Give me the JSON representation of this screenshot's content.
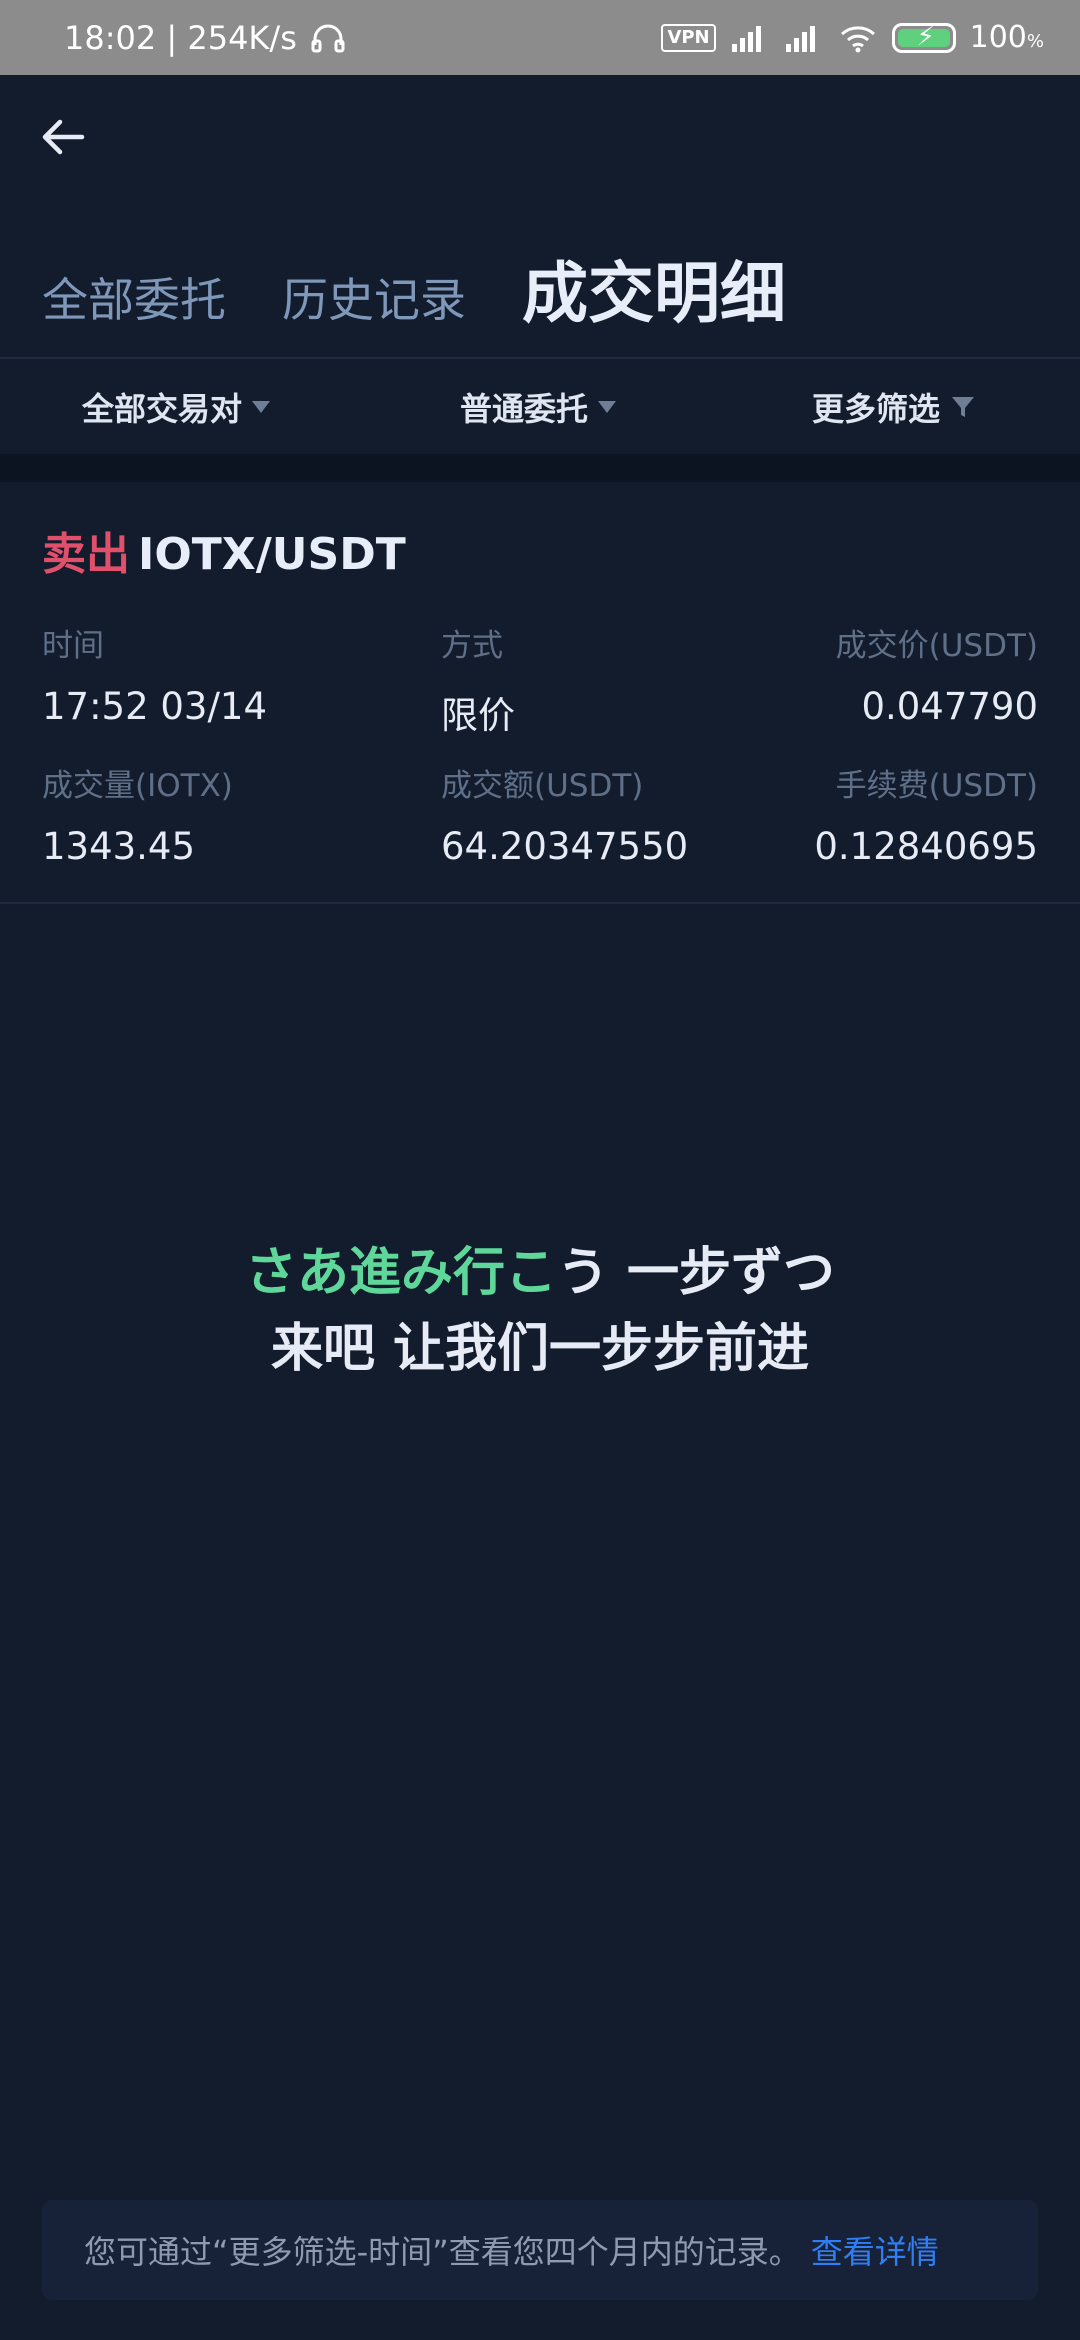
{
  "status_bar": {
    "time_speed": "18:02 | 254K/s",
    "vpn": "VPN",
    "battery": "100",
    "battery_unit": "%"
  },
  "tabs": [
    {
      "label": "全部委托",
      "active": false
    },
    {
      "label": "历史记录",
      "active": false
    },
    {
      "label": "成交明细",
      "active": true
    }
  ],
  "filters": {
    "pairs": "全部交易对",
    "order_type": "普通委托",
    "more": "更多筛选"
  },
  "trade": {
    "side": "卖出",
    "pair": "IOTX/USDT",
    "labels": {
      "time": "时间",
      "method": "方式",
      "price": "成交价(USDT)",
      "volume": "成交量(IOTX)",
      "amount": "成交额(USDT)",
      "fee": "手续费(USDT)"
    },
    "values": {
      "time": "17:52 03/14",
      "method": "限价",
      "price": "0.047790",
      "volume": "1343.45",
      "amount": "64.20347550",
      "fee": "0.12840695"
    }
  },
  "subtitle": {
    "line1_green": "さあ進み行こ",
    "line1_rest": "う 一步ずつ",
    "line2": "来吧 让我们一步步前进"
  },
  "notice": {
    "text": "您可通过“更多筛选-时间”查看您四个月内的记录。",
    "link": "查看详情"
  },
  "colors": {
    "background": "#131c2d",
    "sell": "#e0506b",
    "link": "#2f7ef3",
    "subtitle_green": "#5fd79a"
  }
}
